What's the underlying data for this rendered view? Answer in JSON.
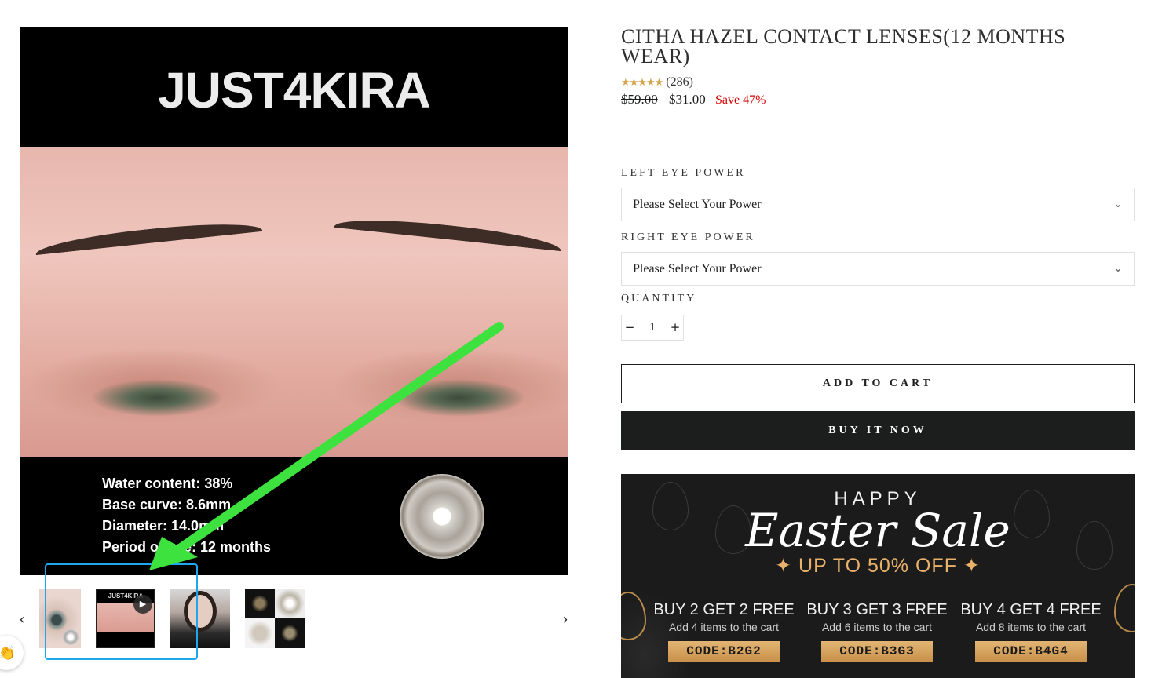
{
  "gallery": {
    "brand_text": "JUST4KIRA",
    "specs": [
      "Water content: 38%",
      "Base curve: 8.6mm",
      "Diameter: 14.0mm",
      "Period of use: 12 months"
    ],
    "thumb_brand": "JUST4KIRA",
    "prev_icon": "chevron-left",
    "next_icon": "chevron-right",
    "play_icon": "play",
    "annotation_color": "#3ee23e",
    "highlight_color": "#1ea7f0"
  },
  "product": {
    "title": "CITHA HAZEL CONTACT LENSES(12 MONTHS WEAR)",
    "rating": 5,
    "review_count": "(286)",
    "compare_price": "$59.00",
    "price": "$31.00",
    "save": "Save 47%",
    "left_eye_label": "LEFT EYE POWER",
    "left_eye_value": "Please Select Your Power",
    "right_eye_label": "RIGHT EYE POWER",
    "right_eye_value": "Please Select Your Power",
    "quantity_label": "QUANTITY",
    "quantity": "1",
    "minus": "−",
    "plus": "+",
    "add_to_cart": "ADD TO CART",
    "buy_now": "BUY IT NOW"
  },
  "promo": {
    "happy": "HAPPY",
    "headline": "Easter Sale",
    "subheadline": "✦ UP TO 50% OFF ✦",
    "accent_color": "#e9b16a",
    "deals": [
      {
        "title": "BUY 2 GET 2 FREE",
        "sub": "Add 4 items to the cart",
        "code": "CODE:B2G2"
      },
      {
        "title": "BUY 3 GET 3 FREE",
        "sub": "Add 6 items to the cart",
        "code": "CODE:B3G3"
      },
      {
        "title": "BUY 4 GET 4 FREE",
        "sub": "Add 8 items to the cart",
        "code": "CODE:B4G4"
      }
    ]
  },
  "chat": {
    "icon": "👏"
  }
}
